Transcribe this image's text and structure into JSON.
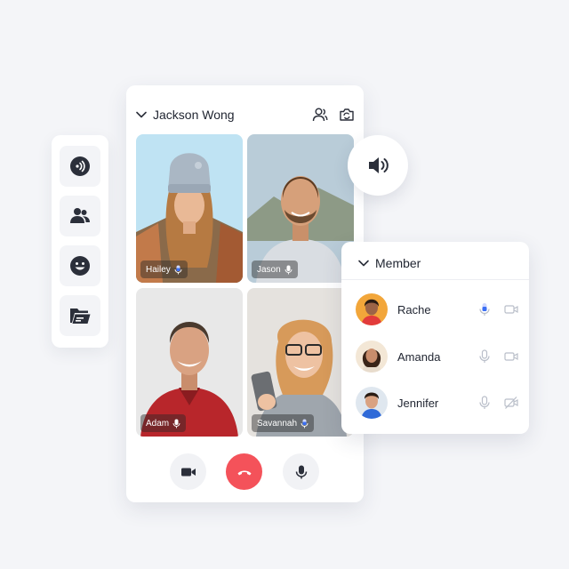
{
  "call": {
    "caller_name": "Jackson Wong",
    "participants": [
      {
        "name": "Hailey"
      },
      {
        "name": "Jason"
      },
      {
        "name": "Adam"
      },
      {
        "name": "Savannah"
      }
    ]
  },
  "members": {
    "title": "Member",
    "list": [
      {
        "name": "Rache",
        "mic": "active",
        "camera": "on"
      },
      {
        "name": "Amanda",
        "mic": "idle",
        "camera": "on"
      },
      {
        "name": "Jennifer",
        "mic": "idle",
        "camera": "off"
      }
    ]
  },
  "rail": {
    "icons": [
      "broadcast-icon",
      "participants-icon",
      "emoji-icon",
      "folder-icon"
    ]
  },
  "colors": {
    "accent_blue": "#3b6ff5",
    "end_call_red": "#f4525a",
    "icon_dark": "#2b2f3a",
    "icon_muted": "#b9bec9"
  }
}
